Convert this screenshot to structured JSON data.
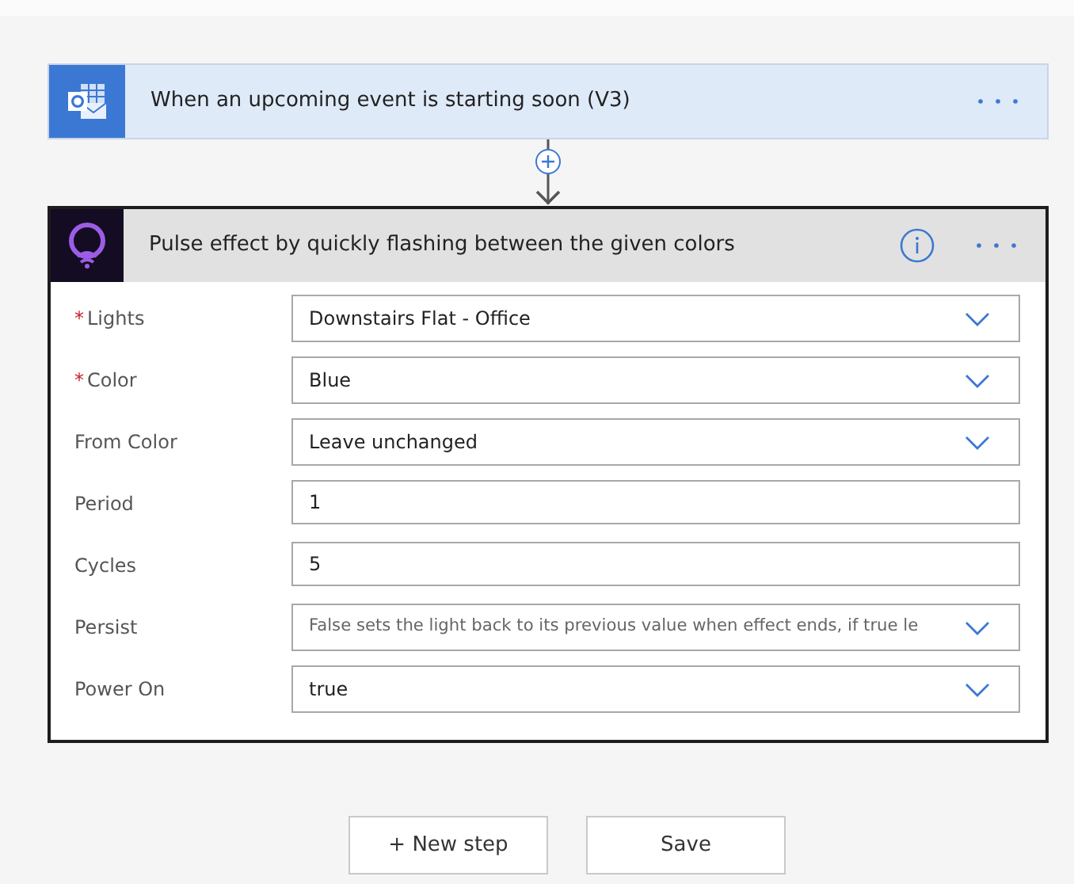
{
  "trigger": {
    "title": "When an upcoming event is starting soon (V3)"
  },
  "action": {
    "title": "Pulse effect by quickly flashing between the given colors",
    "fields": [
      {
        "label": "Lights",
        "marker": "*",
        "kind": "dropdown",
        "value": "Downstairs Flat - Office"
      },
      {
        "label": "Color",
        "marker": "*",
        "kind": "dropdown",
        "value": "Blue"
      },
      {
        "label": "From Color",
        "kind": "dropdown",
        "value": "Leave unchanged"
      },
      {
        "label": "Period",
        "kind": "text",
        "value": "1"
      },
      {
        "label": "Cycles",
        "kind": "text",
        "value": "5"
      },
      {
        "label": "Persist",
        "kind": "dropdown",
        "placeholder": "False sets the light back to its previous value when effect ends, if true le"
      },
      {
        "label": "Power On",
        "kind": "dropdown",
        "value": "true"
      }
    ]
  },
  "buttons": [
    "+ New step",
    "Save"
  ]
}
